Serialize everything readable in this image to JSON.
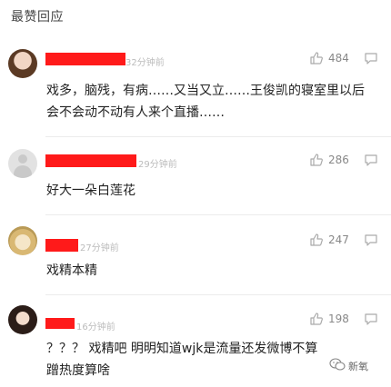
{
  "section_title": "最赞回应",
  "comments": [
    {
      "time": "32分钟前",
      "likes": "484",
      "text": "戏多，脑残，有病……又当又立……王俊凯的寝室里以后会不会动不动有人来个直播……"
    },
    {
      "time": "29分钟前",
      "likes": "286",
      "text": "好大一朵白莲花"
    },
    {
      "time": "27分钟前",
      "likes": "247",
      "text": "戏精本精"
    },
    {
      "time": "16分钟前",
      "likes": "198",
      "text": "？？？ 戏精吧 明明知道wjk是流量还发微博不算蹭热度算啥"
    }
  ],
  "watermark": {
    "label": "新氧"
  },
  "colors": {
    "redaction": "#ff1a1a",
    "meta_text": "#bbbbbb",
    "divider": "#ececec"
  },
  "icons": {
    "like": "thumbs-up-icon",
    "reply": "reply-icon",
    "avatar_placeholder": "user-icon",
    "watermark": "wechat-icon"
  }
}
